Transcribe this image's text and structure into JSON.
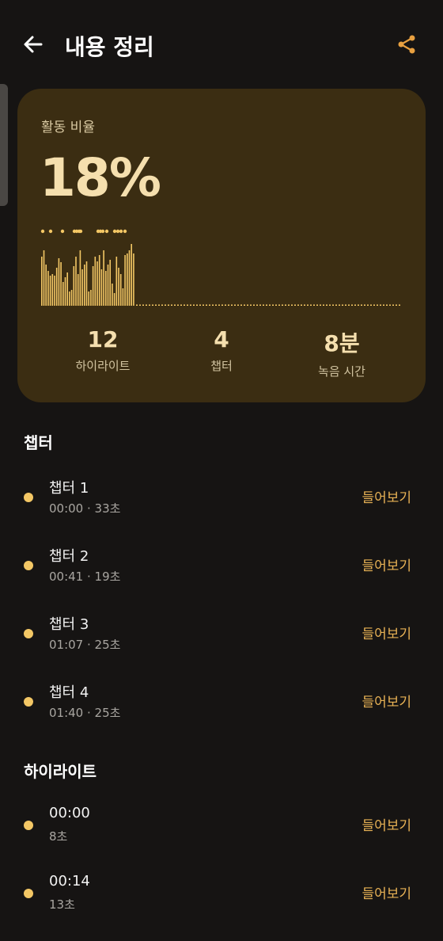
{
  "header": {
    "title": "내용 정리"
  },
  "summary": {
    "label": "활동 비율",
    "percent": "18%",
    "stats": [
      {
        "value": "12",
        "label": "하이라이트"
      },
      {
        "value": "4",
        "label": "챕터"
      },
      {
        "value": "8분",
        "label": "녹음 시간"
      }
    ],
    "accent_color": "#f3c765"
  },
  "chapters": {
    "title": "챕터",
    "items": [
      {
        "title": "챕터 1",
        "sub": "00:00 · 33초",
        "action": "들어보기"
      },
      {
        "title": "챕터 2",
        "sub": "00:41 · 19초",
        "action": "들어보기"
      },
      {
        "title": "챕터 3",
        "sub": "01:07 · 25초",
        "action": "들어보기"
      },
      {
        "title": "챕터 4",
        "sub": "01:40 · 25초",
        "action": "들어보기"
      }
    ]
  },
  "highlights": {
    "title": "하이라이트",
    "items": [
      {
        "title": "00:00",
        "sub": "8초",
        "action": "들어보기"
      },
      {
        "title": "00:14",
        "sub": "13초",
        "action": "들어보기"
      }
    ]
  }
}
